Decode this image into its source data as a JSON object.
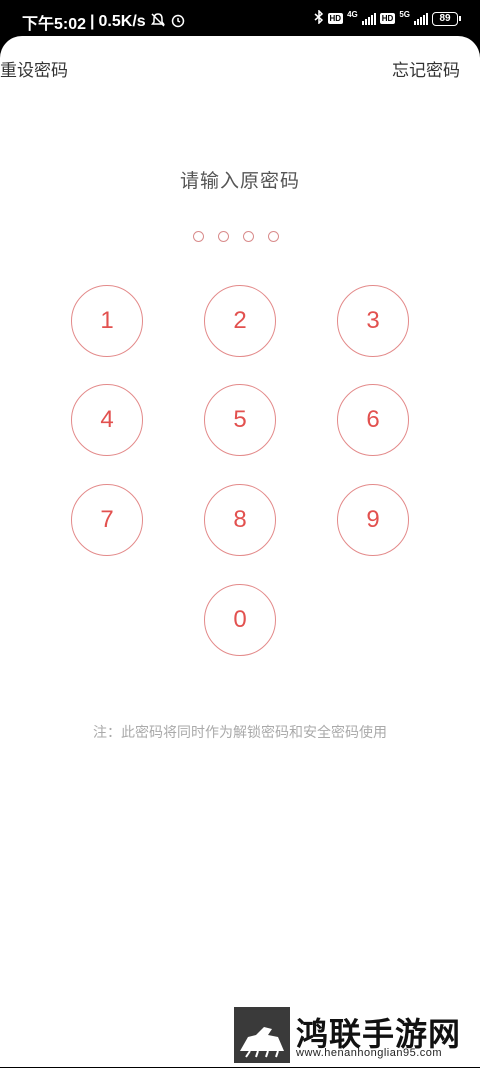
{
  "status_bar": {
    "time": "下午5:02",
    "separator": "|",
    "speed": "0.5K/s",
    "hd1": "HD",
    "net1": "4G",
    "hd2": "HD",
    "net2": "5G",
    "battery": "89"
  },
  "header": {
    "reset_label": "重设密码",
    "forgot_label": "忘记密码"
  },
  "prompt": "请输入原密码",
  "pin": {
    "length": 4,
    "filled": 0
  },
  "keypad": [
    "1",
    "2",
    "3",
    "4",
    "5",
    "6",
    "7",
    "8",
    "9",
    "0"
  ],
  "note": "注：此密码将同时作为解锁密码和安全密码使用",
  "watermark": {
    "title": "鸿联手游网",
    "url": "www.henanhonglian95.com"
  },
  "colors": {
    "accent": "#e2514f",
    "key_border": "#e38a8a",
    "text": "#333333",
    "hint": "#aaaaaa"
  }
}
